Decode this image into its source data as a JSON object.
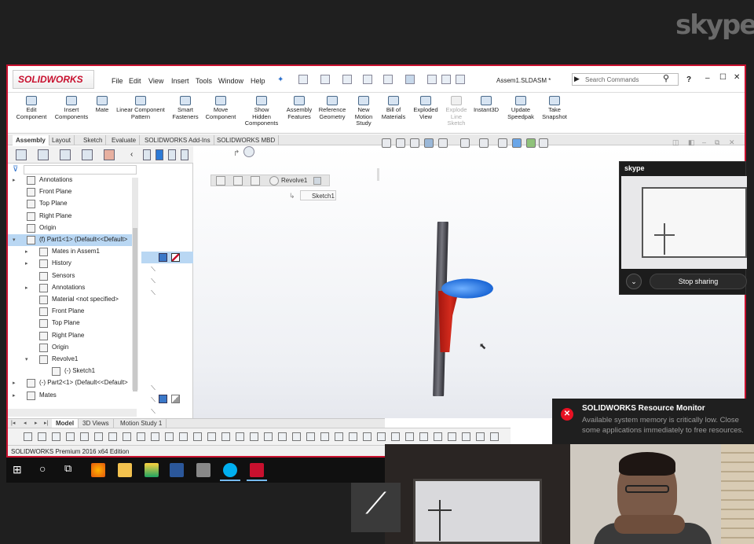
{
  "skype": {
    "logo": "skype",
    "panel_logo": "skype",
    "stop_sharing": "Stop sharing"
  },
  "app": {
    "logo": "SOLIDWORKS",
    "menu": [
      "File",
      "Edit",
      "View",
      "Insert",
      "Tools",
      "Window",
      "Help"
    ],
    "document_title": "Assem1.SLDASM *",
    "search_placeholder": "Search Commands",
    "help_label": "?"
  },
  "commands": [
    {
      "label": "Edit Component",
      "lines": [
        "Edit",
        "Component"
      ]
    },
    {
      "label": "Insert Components",
      "lines": [
        "Insert",
        "Components"
      ]
    },
    {
      "label": "Mate",
      "lines": [
        "Mate"
      ]
    },
    {
      "label": "Linear Component Pattern",
      "lines": [
        "Linear Component",
        "Pattern"
      ]
    },
    {
      "label": "Smart Fasteners",
      "lines": [
        "Smart",
        "Fasteners"
      ]
    },
    {
      "label": "Move Component",
      "lines": [
        "Move",
        "Component"
      ]
    },
    {
      "label": "Show Hidden Components",
      "lines": [
        "Show",
        "Hidden",
        "Components"
      ]
    },
    {
      "label": "Assembly Features",
      "lines": [
        "Assembly",
        "Features"
      ]
    },
    {
      "label": "Reference Geometry",
      "lines": [
        "Reference",
        "Geometry"
      ]
    },
    {
      "label": "New Motion Study",
      "lines": [
        "New",
        "Motion",
        "Study"
      ]
    },
    {
      "label": "Bill of Materials",
      "lines": [
        "Bill of",
        "Materials"
      ]
    },
    {
      "label": "Exploded View",
      "lines": [
        "Exploded",
        "View"
      ]
    },
    {
      "label": "Explode Line Sketch",
      "lines": [
        "Explode",
        "Line",
        "Sketch"
      ]
    },
    {
      "label": "Instant3D",
      "lines": [
        "Instant3D"
      ]
    },
    {
      "label": "Update Speedpak",
      "lines": [
        "Update",
        "Speedpak"
      ]
    },
    {
      "label": "Take Snapshot",
      "lines": [
        "Take",
        "Snapshot"
      ]
    }
  ],
  "tabs": [
    "Assembly",
    "Layout",
    "Sketch",
    "Evaluate",
    "SOLIDWORKS Add-Ins",
    "SOLIDWORKS MBD"
  ],
  "tree": [
    {
      "label": "Annotations",
      "indent": 0,
      "expander": "▸"
    },
    {
      "label": "Front Plane",
      "indent": 0,
      "expander": ""
    },
    {
      "label": "Top Plane",
      "indent": 0,
      "expander": ""
    },
    {
      "label": "Right Plane",
      "indent": 0,
      "expander": ""
    },
    {
      "label": "Origin",
      "indent": 0,
      "expander": ""
    },
    {
      "label": "(f) Part1<1> (Default<<Default>",
      "indent": 0,
      "expander": "▾",
      "selected": true
    },
    {
      "label": "Mates in Assem1",
      "indent": 1,
      "expander": "▸"
    },
    {
      "label": "History",
      "indent": 1,
      "expander": "▸"
    },
    {
      "label": "Sensors",
      "indent": 1,
      "expander": ""
    },
    {
      "label": "Annotations",
      "indent": 1,
      "expander": "▸"
    },
    {
      "label": "Material <not specified>",
      "indent": 1,
      "expander": ""
    },
    {
      "label": "Front Plane",
      "indent": 1,
      "expander": ""
    },
    {
      "label": "Top Plane",
      "indent": 1,
      "expander": ""
    },
    {
      "label": "Right Plane",
      "indent": 1,
      "expander": ""
    },
    {
      "label": "Origin",
      "indent": 1,
      "expander": ""
    },
    {
      "label": "Revolve1",
      "indent": 1,
      "expander": "▾"
    },
    {
      "label": "(-) Sketch1",
      "indent": 2,
      "expander": ""
    },
    {
      "label": "(-) Part2<1> (Default<<Default>",
      "indent": 0,
      "expander": "▸"
    },
    {
      "label": "Mates",
      "indent": 0,
      "expander": "▸"
    }
  ],
  "breadcrumb": {
    "feature": "Revolve1",
    "sketch": "Sketch1"
  },
  "bottom_tabs": [
    "Model",
    "3D Views",
    "Motion Study 1"
  ],
  "status_text": "SOLIDWORKS Premium 2016 x64 Edition",
  "notification": {
    "title": "SOLIDWORKS Resource Monitor",
    "body": "Available system memory is critically low. Close some applications immediately to free resources."
  },
  "colors": {
    "sw_red": "#c8102e",
    "part_red": "#d42b1d",
    "part_blue": "#1b67d6",
    "shaft_gray": "#5a5a62"
  }
}
